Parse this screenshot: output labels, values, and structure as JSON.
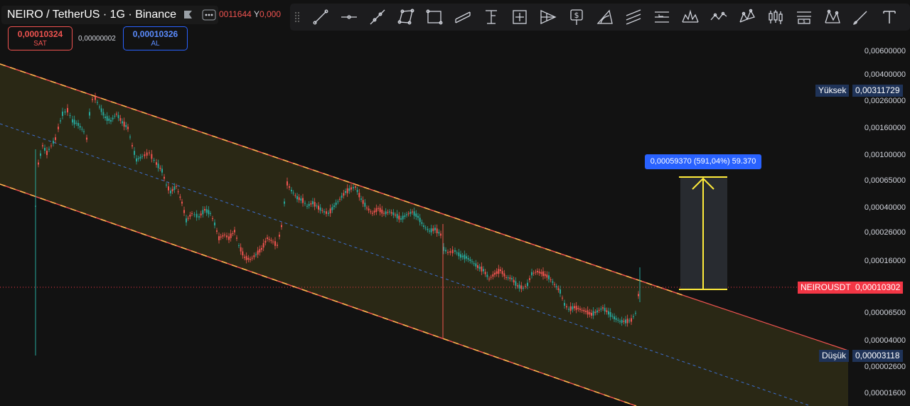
{
  "header": {
    "symbol_title": "NEIRO / TetherUS · 1G · Binance",
    "ohlc_close_fragment": "0011644",
    "ohlc_y_label": "Y",
    "ohlc_y_value": "0,000"
  },
  "trade": {
    "sell_price": "0,00010324",
    "sell_label": "SAT",
    "spread": "0,00000002",
    "buy_price": "0,00010326",
    "buy_label": "AL"
  },
  "toolbar": {
    "tools": [
      "trend-line",
      "horizontal-ray",
      "extended-line",
      "polygon",
      "rectangle",
      "parallel-channel",
      "vertical-measure",
      "price-range",
      "pitchfork",
      "price-note",
      "arc",
      "fib-channel",
      "info-line",
      "head-shoulders",
      "path",
      "pattern",
      "long-position",
      "price-label-s",
      "xabcd",
      "brush",
      "text"
    ]
  },
  "price_axis": {
    "labels": [
      "0,00600000",
      "0,00400000",
      "0,00260000",
      "0,00160000",
      "0,00100000",
      "0,00065000",
      "0,00040000",
      "0,00026000",
      "0,00016000",
      "0,00006500",
      "0,00004000",
      "0,00002600",
      "0,00001600"
    ],
    "high": {
      "label": "Yüksek",
      "value": "0,00311729"
    },
    "current": {
      "label": "NEIROUSDT",
      "value": "0,00010302"
    },
    "low": {
      "label": "Düşük",
      "value": "0,00003118"
    }
  },
  "measure": {
    "text": "0,00059370 (591,04%) 59.370"
  },
  "colors": {
    "background": "#121212",
    "up": "#26a69a",
    "down": "#ef5350",
    "channel_fill": "#2c2a16",
    "channel_line": "#ff9800",
    "accent_blue": "#2962ff",
    "current_price": "#f23645",
    "yellow": "#ffeb3b"
  }
}
